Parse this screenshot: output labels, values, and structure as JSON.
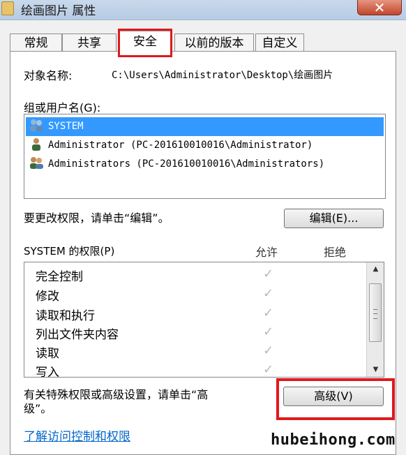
{
  "window": {
    "title": "绘画图片 属性",
    "close_label": "✕"
  },
  "tabs": [
    {
      "label": "常规",
      "active": false
    },
    {
      "label": "共享",
      "active": false
    },
    {
      "label": "安全",
      "active": true
    },
    {
      "label": "以前的版本",
      "active": false
    },
    {
      "label": "自定义",
      "active": false
    }
  ],
  "object": {
    "label": "对象名称:",
    "path": "C:\\Users\\Administrator\\Desktop\\绘画图片"
  },
  "groups": {
    "label": "组或用户名(G):",
    "users": [
      {
        "name": "SYSTEM",
        "icon": "group-users-icon",
        "selected": true
      },
      {
        "name": "Administrator (PC-201610010016\\Administrator)",
        "icon": "user-icon",
        "selected": false
      },
      {
        "name": "Administrators (PC-201610010016\\Administrators)",
        "icon": "group-users-icon",
        "selected": false
      }
    ]
  },
  "edit": {
    "hint": "要更改权限，请单击“编辑”。",
    "button_label": "编辑(E)..."
  },
  "permissions": {
    "label": "SYSTEM 的权限(P)",
    "allow_header": "允许",
    "deny_header": "拒绝",
    "rows": [
      {
        "name": "完全控制",
        "allow": "✓"
      },
      {
        "name": "修改",
        "allow": "✓"
      },
      {
        "name": "读取和执行",
        "allow": "✓"
      },
      {
        "name": "列出文件夹内容",
        "allow": "✓"
      },
      {
        "name": "读取",
        "allow": "✓"
      },
      {
        "name": "写入",
        "allow": "✓"
      }
    ]
  },
  "advanced": {
    "hint_line1": "有关特殊权限或高级设置，请单击“高",
    "hint_line2": "级”。",
    "button_label": "高级(V)"
  },
  "link": {
    "label": "了解访问控制和权限"
  },
  "watermark": "hubeihong.com",
  "colors": {
    "highlight": "#e0191c",
    "selection": "#3399ff",
    "link": "#0066cc"
  }
}
